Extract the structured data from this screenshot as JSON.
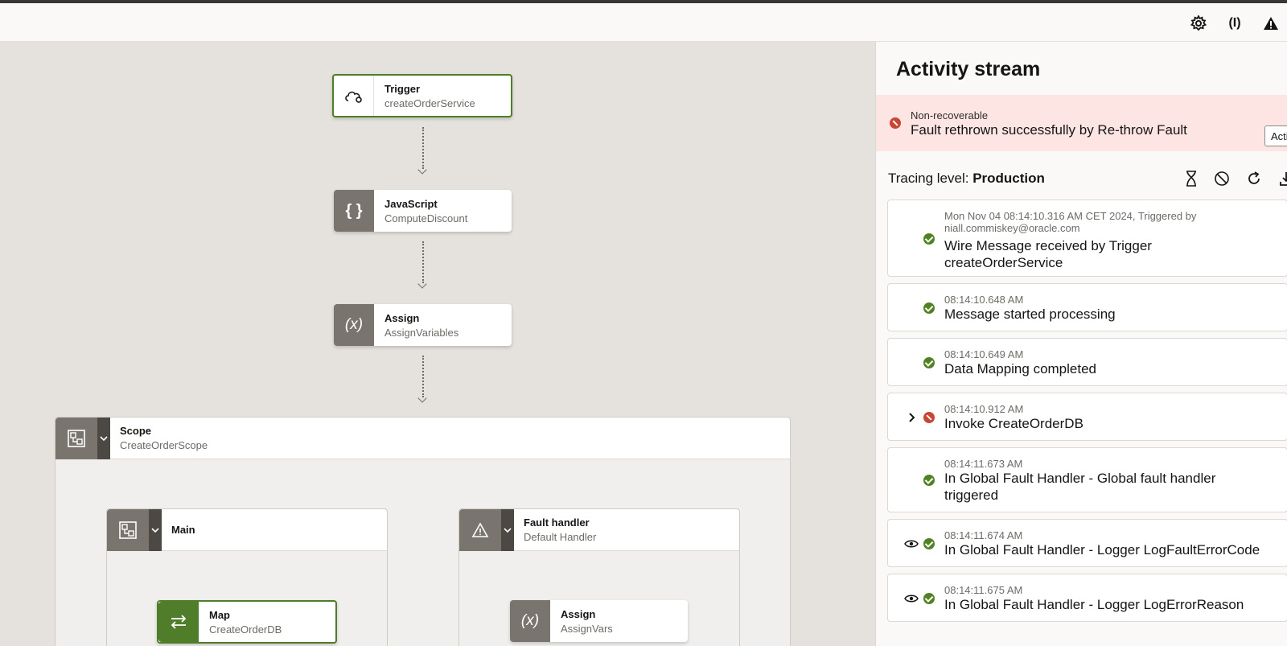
{
  "header": {
    "icons": [
      "gear-icon",
      "variable-icon",
      "warning-icon"
    ]
  },
  "flow": {
    "trigger": {
      "title": "Trigger",
      "subtitle": "createOrderService"
    },
    "javascript": {
      "icon": "{ }",
      "title": "JavaScript",
      "subtitle": "ComputeDiscount"
    },
    "assign": {
      "icon": "(x)",
      "title": "Assign",
      "subtitle": "AssignVariables"
    },
    "scope": {
      "title": "Scope",
      "subtitle": "CreateOrderScope"
    },
    "main": {
      "title": "Main"
    },
    "fault_handler": {
      "title": "Fault handler",
      "subtitle": "Default Handler"
    },
    "map": {
      "title": "Map",
      "subtitle": "CreateOrderDB"
    },
    "assign_vars": {
      "icon": "(x)",
      "title": "Assign",
      "subtitle": "AssignVars"
    }
  },
  "panel": {
    "title": "Activity stream",
    "fault": {
      "label": "Non-recoverable",
      "message": "Fault rethrown successfully by Re-throw Fault",
      "action_label": "Acti"
    },
    "tracing_label": "Tracing level:",
    "tracing_value": "Production",
    "entries": [
      {
        "meta": "Mon Nov 04 08:14:10.316 AM CET 2024, Triggered by niall.commiskey@oracle.com",
        "message": "Wire Message received by Trigger createOrderService",
        "status": "ok"
      },
      {
        "meta": "08:14:10.648 AM",
        "message": "Message started processing",
        "status": "ok"
      },
      {
        "meta": "08:14:10.649 AM",
        "message": "Data Mapping completed",
        "status": "ok"
      },
      {
        "meta": "08:14:10.912 AM",
        "message": "Invoke CreateOrderDB",
        "status": "error"
      },
      {
        "meta": "08:14:11.673 AM",
        "message": "In Global Fault Handler - Global fault handler triggered",
        "status": "ok"
      },
      {
        "meta": "08:14:11.674 AM",
        "message": "In Global Fault Handler - Logger LogFaultErrorCode",
        "status": "ok"
      },
      {
        "meta": "08:14:11.675 AM",
        "message": "In Global Fault Handler - Logger LogErrorReason",
        "status": "ok"
      }
    ]
  }
}
